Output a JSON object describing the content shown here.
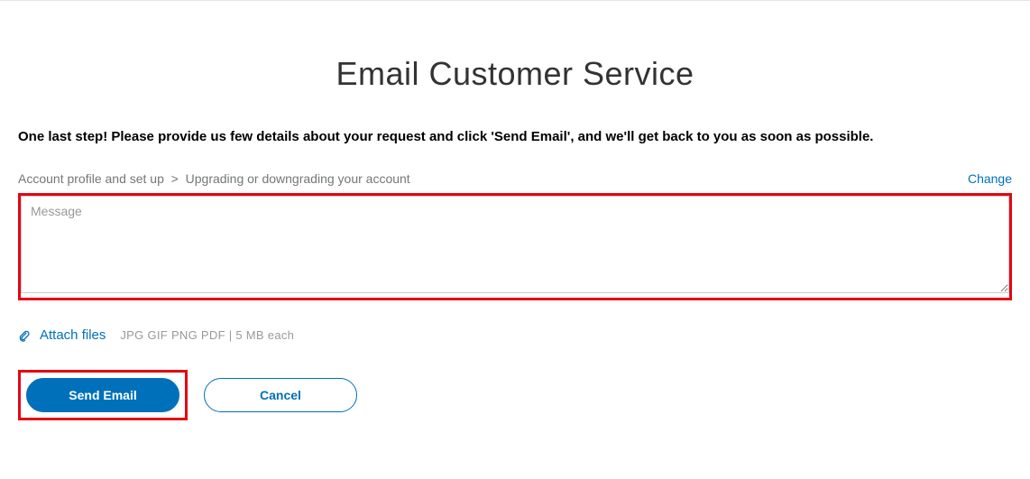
{
  "header": {
    "title": "Email Customer Service"
  },
  "instruction": "One last step! Please provide us few details about your request and click 'Send Email', and we'll get back to you as soon as possible.",
  "breadcrumb": {
    "category": "Account profile and set up",
    "separator": ">",
    "subcategory": "Upgrading or downgrading your account"
  },
  "change_link": "Change",
  "message": {
    "placeholder": "Message",
    "value": ""
  },
  "attach": {
    "label": "Attach files",
    "hint": "JPG GIF PNG PDF   |   5 MB each"
  },
  "buttons": {
    "send": "Send Email",
    "cancel": "Cancel"
  }
}
